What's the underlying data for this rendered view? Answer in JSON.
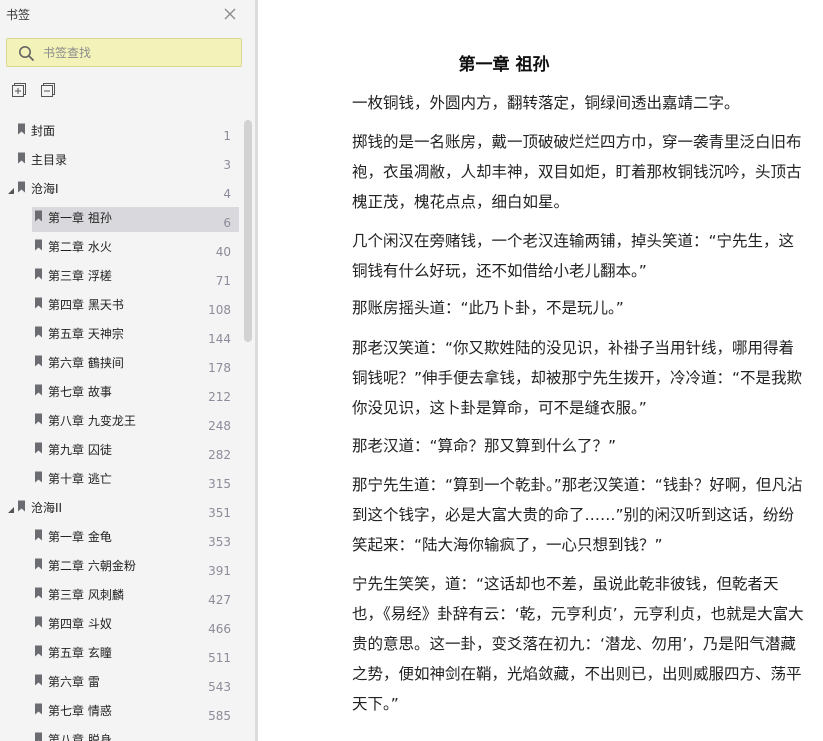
{
  "sidebar": {
    "title": "书签",
    "search": {
      "placeholder": "书签查找",
      "value": ""
    },
    "toc": [
      {
        "label": "封面",
        "page": "1",
        "level": 0
      },
      {
        "label": "主目录",
        "page": "3",
        "level": 0
      },
      {
        "label": "沧海I",
        "page": "4",
        "level": 0,
        "expanded": true
      },
      {
        "label": "第一章  祖孙",
        "page": "6",
        "level": 1,
        "selected": true
      },
      {
        "label": "第二章  水火",
        "page": "40",
        "level": 1
      },
      {
        "label": "第三章  浮槎",
        "page": "71",
        "level": 1
      },
      {
        "label": "第四章  黑天书",
        "page": "108",
        "level": 1
      },
      {
        "label": "第五章  天神宗",
        "page": "144",
        "level": 1
      },
      {
        "label": "第六章  鶴挟间",
        "page": "178",
        "level": 1
      },
      {
        "label": "第七章  故事",
        "page": "212",
        "level": 1
      },
      {
        "label": "第八章  九变龙王",
        "page": "248",
        "level": 1
      },
      {
        "label": "第九章  囚徒",
        "page": "282",
        "level": 1
      },
      {
        "label": "第十章  逃亡",
        "page": "315",
        "level": 1
      },
      {
        "label": "沧海II",
        "page": "351",
        "level": 0,
        "expanded": true
      },
      {
        "label": "第一章  金龟",
        "page": "353",
        "level": 1
      },
      {
        "label": "第二章  六朝金粉",
        "page": "391",
        "level": 1
      },
      {
        "label": "第三章  风刺麟",
        "page": "427",
        "level": 1
      },
      {
        "label": "第四章  斗奴",
        "page": "466",
        "level": 1
      },
      {
        "label": "第五章  玄瞳",
        "page": "511",
        "level": 1
      },
      {
        "label": "第六章  雷",
        "page": "543",
        "level": 1
      },
      {
        "label": "第七章  情惑",
        "page": "585",
        "level": 1
      },
      {
        "label": "第八章  脱身",
        "page": "",
        "level": 1
      }
    ]
  },
  "document": {
    "chapter_title": "第一章 祖孙",
    "paragraphs": [
      "一枚铜钱，外圆内方，翻转落定，铜绿间透出嘉靖二字。",
      "掷钱的是一名账房，戴一顶破破烂烂四方巾，穿一袭青里泛白旧布袍，衣虽凋敝，人却丰神，双目如炬，盯着那枚铜钱沉吟，头顶古槐正茂，槐花点点，细白如星。",
      "几个闲汉在旁赌钱，一个老汉连输两铺，掉头笑道：“宁先生，这铜钱有什么好玩，还不如借给小老儿翻本。”",
      "那账房摇头道：“此乃卜卦，不是玩儿。”",
      "那老汉笑道：“你又欺姓陆的没见识，补褂子当用针线，哪用得着铜钱呢？”伸手便去拿钱，却被那宁先生拨开，冷冷道：“不是我欺你没见识，这卜卦是算命，可不是缝衣服。”",
      "那老汉道：“算命？那又算到什么了？”",
      "那宁先生道：“算到一个乾卦。”那老汉笑道：“钱卦？好啊，但凡沾到这个钱字，必是大富大贵的命了……”别的闲汉听到这话，纷纷笑起来：“陆大海你输疯了，一心只想到钱？”",
      "宁先生笑笑，道：“这话却也不差，虽说此乾非彼钱，但乾者天也，《易经》卦辞有云：‘乾，元亨利贞’，元亨利贞，也就是大富大贵的意思。这一卦，变爻落在初九：‘潜龙、勿用’，乃是阳气潜藏之势，便如神剑在鞘，光焰敛藏，不出则已，出则威服四方、荡平天下。”"
    ]
  },
  "colors": {
    "sidebar_bg": "#f4f4f4",
    "search_bg": "#f3f3b9",
    "selected_bg": "#d9d9dd",
    "page_number": "#8c8c9a"
  },
  "icons": {
    "close": "close-icon",
    "search": "search-icon",
    "expand_all": "expand-all-icon",
    "collapse_all": "collapse-all-icon",
    "bookmark": "bookmark-icon",
    "caret": "caret-down-icon"
  }
}
